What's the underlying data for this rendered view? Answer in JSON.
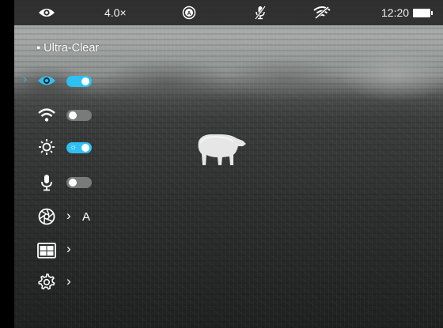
{
  "status_bar": {
    "mode_icon": "eye-icon",
    "zoom": "4.0×",
    "auto_icon": "auto-icon",
    "mic_icon": "mic-off-icon",
    "wifi_icon": "wifi-off-icon",
    "time": "12:20",
    "battery_icon": "battery-full-icon"
  },
  "menu": {
    "title": "Ultra-Clear",
    "cursor": "›",
    "items": [
      {
        "icon": "eye-icon",
        "type": "toggle",
        "on": true
      },
      {
        "icon": "wifi-icon",
        "type": "toggle",
        "on": false
      },
      {
        "icon": "brightness-icon",
        "type": "toggle",
        "on": true
      },
      {
        "icon": "microphone-icon",
        "type": "toggle",
        "on": false
      },
      {
        "icon": "aperture-icon",
        "type": "submenu",
        "value": "A",
        "chevron": "›"
      },
      {
        "icon": "layout-icon",
        "type": "submenu",
        "chevron": "›"
      },
      {
        "icon": "settings-icon",
        "type": "submenu",
        "chevron": "›"
      }
    ]
  },
  "colors": {
    "accent": "#2ec0f0",
    "toggle_off": "#7a7a7a",
    "status_bg": "#282828"
  }
}
